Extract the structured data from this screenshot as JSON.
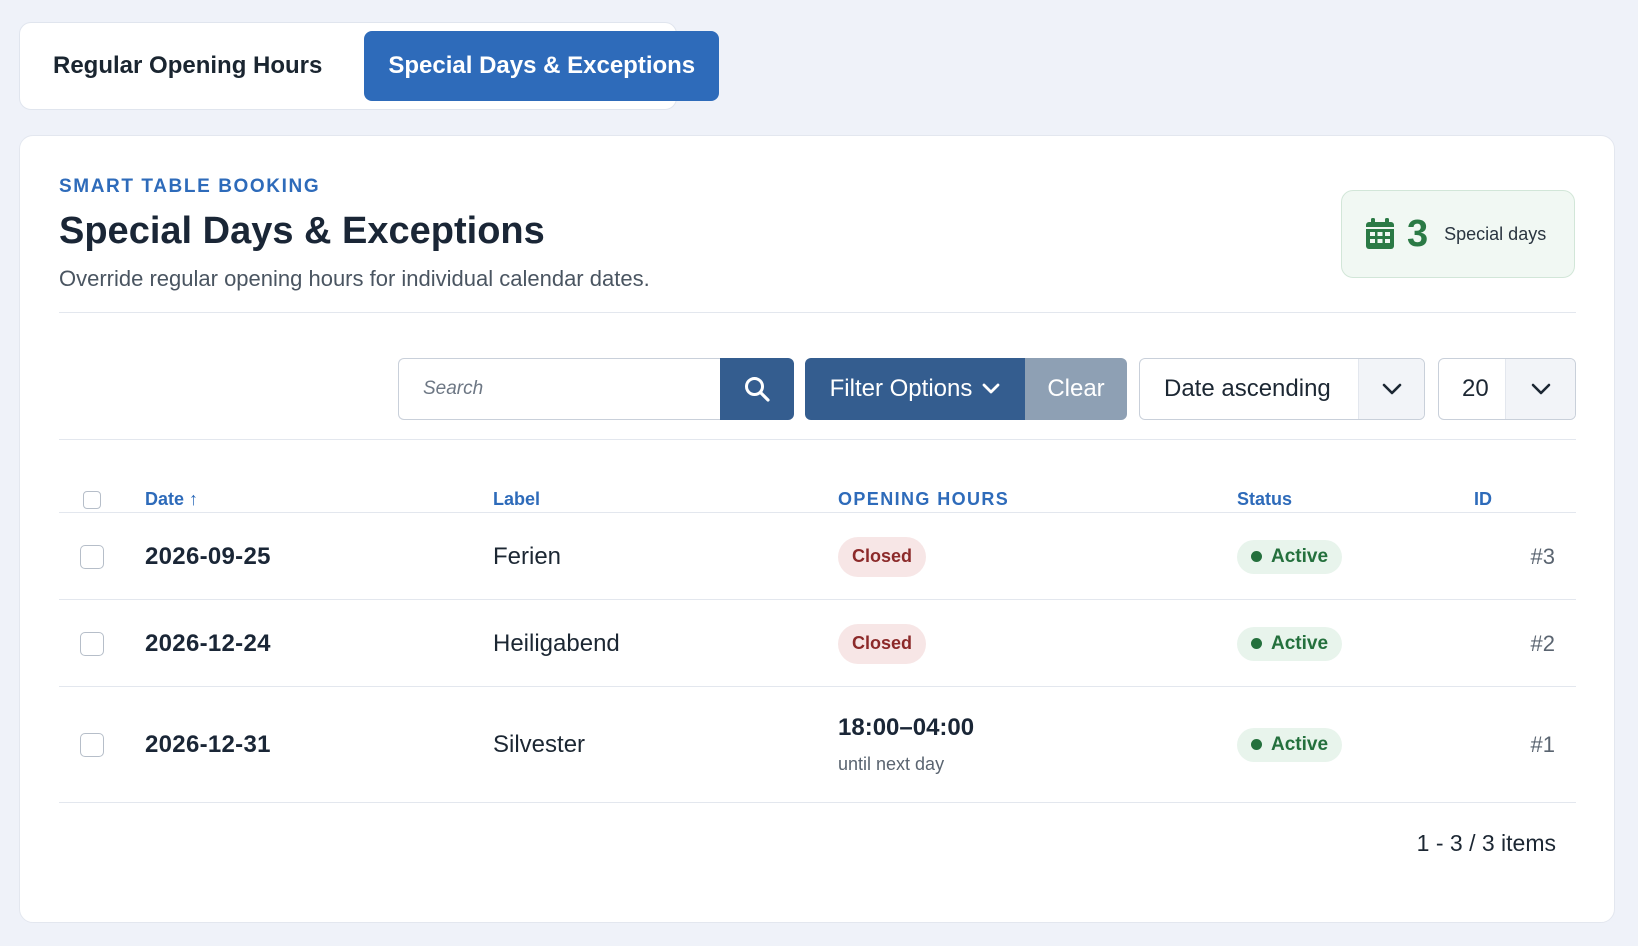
{
  "tabs": [
    {
      "label": "Regular Opening Hours",
      "active": false
    },
    {
      "label": "Special Days & Exceptions",
      "active": true
    }
  ],
  "header": {
    "eyebrow": "SMART TABLE BOOKING",
    "title": "Special Days & Exceptions",
    "subtitle": "Override regular opening hours for individual calendar dates."
  },
  "counter": {
    "icon": "calendar-icon",
    "value": "3",
    "label": "Special days"
  },
  "toolbar": {
    "search_placeholder": "Search",
    "filter_label": "Filter Options",
    "clear_label": "Clear",
    "sort_value": "Date ascending",
    "page_size_value": "20"
  },
  "table": {
    "columns": {
      "date": "Date ↑",
      "label": "Label",
      "hours": "OPENING HOURS",
      "status": "Status",
      "id": "ID"
    },
    "rows": [
      {
        "date": "2026-09-25",
        "label": "Ferien",
        "hours_badge": "Closed",
        "status": "Active",
        "id": "#3"
      },
      {
        "date": "2026-12-24",
        "label": "Heiligabend",
        "hours_badge": "Closed",
        "status": "Active",
        "id": "#2"
      },
      {
        "date": "2026-12-31",
        "label": "Silvester",
        "hours_time": "18:00–04:00",
        "hours_note": "until next day",
        "status": "Active",
        "id": "#1"
      }
    ]
  },
  "pager": {
    "summary": "1 - 3 / 3 items"
  },
  "colors": {
    "accent": "#2e6bba",
    "button_dark": "#345d8f",
    "button_muted": "#8ea0b4",
    "success": "#24703d",
    "danger": "#8c2a2a"
  }
}
